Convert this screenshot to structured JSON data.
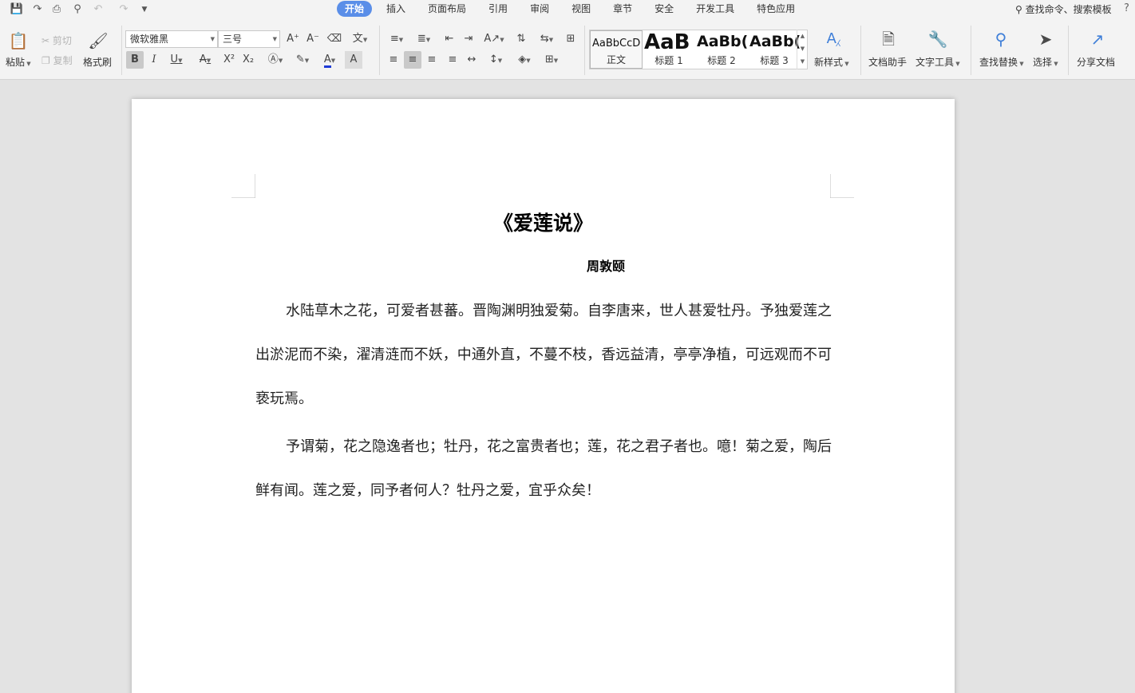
{
  "quick_access": {
    "icons": [
      "save-icon",
      "export-icon",
      "print-icon",
      "print-preview-icon",
      "undo-icon",
      "redo-icon",
      "customize-icon"
    ]
  },
  "tabs": [
    "开始",
    "插入",
    "页面布局",
    "引用",
    "审阅",
    "视图",
    "章节",
    "安全",
    "开发工具",
    "特色应用"
  ],
  "active_tab": "开始",
  "search_command": "查找命令、搜索模板",
  "ribbon": {
    "paste": "粘贴",
    "cut": "剪切",
    "copy": "复制",
    "format_painter": "格式刷",
    "font_name": "微软雅黑",
    "font_size": "三号",
    "styles": [
      {
        "sample": "AaBbCcD",
        "name": "正文"
      },
      {
        "sample": "AaB",
        "name": "标题 1"
      },
      {
        "sample": "AaBb(",
        "name": "标题 2"
      },
      {
        "sample": "AaBb(",
        "name": "标题 3"
      }
    ],
    "new_style": "新样式",
    "doc_assistant": "文档助手",
    "text_tools": "文字工具",
    "find_replace": "查找替换",
    "select": "选择",
    "share_doc": "分享文档"
  },
  "document": {
    "title": "《爱莲说》",
    "author": "周敦颐",
    "paragraphs": [
      "水陆草木之花，可爱者甚蕃。晋陶渊明独爱菊。自李唐来，世人甚爱牡丹。予独爱莲之出淤泥而不染，濯清涟而不妖，中通外直，不蔓不枝，香远益清，亭亭净植，可远观而不可亵玩焉。",
      "予谓菊，花之隐逸者也；牡丹，花之富贵者也；莲，花之君子者也。噫！菊之爱，陶后鲜有闻。莲之爱，同予者何人？牡丹之爱，宜乎众矣！"
    ]
  },
  "colors": {
    "active_tab": "#5a8ee8",
    "ribbon_bg": "#f3f3f3",
    "canvas_bg": "#e3e3e3"
  }
}
